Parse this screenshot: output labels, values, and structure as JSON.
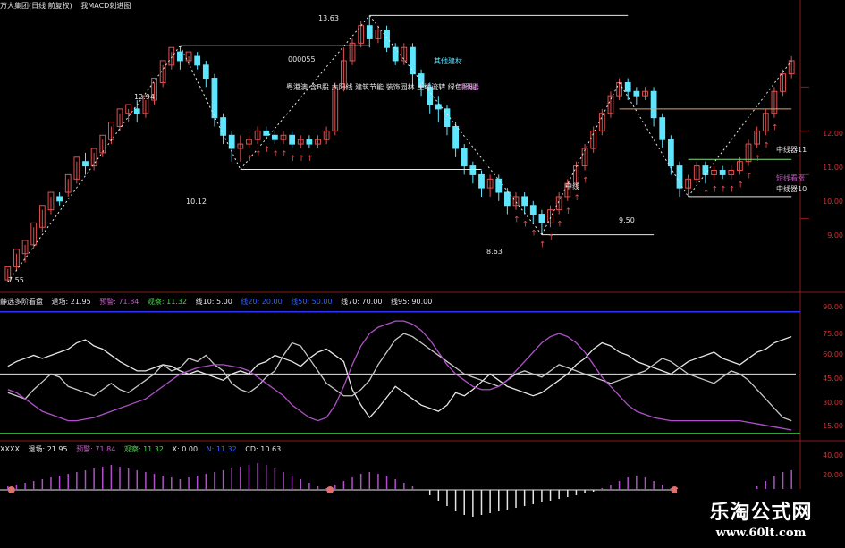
{
  "header": {
    "title": "万大集团(日线 前复权)",
    "indicator": "我MACD刺进图"
  },
  "colors": {
    "up": "#e05050",
    "down": "#5fe6ff",
    "white": "#e6e6e6",
    "magenta": "#b050c8",
    "grid": "#8b1a1a"
  },
  "price_panel": {
    "y_axis": [
      "12.00",
      "11.00",
      "10.00",
      "9.00"
    ],
    "price_labels": [
      "13.63",
      "12.94",
      "10.12",
      "8.63",
      "9.50",
      "7.55"
    ],
    "code_label": "000055",
    "tags": [
      "其他建材",
      "粤港澳 含B股 大阳线 建筑节能 装饰园林 土地流转 绿色照明",
      "中线器"
    ],
    "right_labels": [
      "中线器11",
      "中线器10",
      "短线看涨"
    ],
    "mid_labels": [
      "中线"
    ]
  },
  "osc_panel": {
    "header": [
      {
        "text": "静选多阶看盘",
        "color": "#e6e6e6"
      },
      {
        "text": "退场: 21.95",
        "color": "#e6e6e6"
      },
      {
        "text": "预警: 71.84",
        "color": "#c060c0"
      },
      {
        "text": "观察: 11.32",
        "color": "#50d050"
      },
      {
        "text": "线10: 5.00",
        "color": "#e6e6e6"
      },
      {
        "text": "线20: 20.00",
        "color": "#3060ff"
      },
      {
        "text": "线50: 50.00",
        "color": "#3060ff"
      },
      {
        "text": "线70: 70.00",
        "color": "#e6e6e6"
      },
      {
        "text": "线95: 90.00",
        "color": "#e6e6e6"
      }
    ],
    "y_axis": [
      "90.00",
      "75.00",
      "60.00",
      "45.00",
      "30.00",
      "15.00"
    ]
  },
  "macd_panel": {
    "header": [
      {
        "text": "XXXX",
        "color": "#e6e6e6"
      },
      {
        "text": "退场: 21.95",
        "color": "#e6e6e6"
      },
      {
        "text": "预警: 71.84",
        "color": "#c060c0"
      },
      {
        "text": "观察: 11.32",
        "color": "#50d050"
      },
      {
        "text": "X: 0.00",
        "color": "#e6e6e6"
      },
      {
        "text": "N: 11.32",
        "color": "#3060ff"
      },
      {
        "text": "CD: 10.63",
        "color": "#e6e6e6"
      }
    ],
    "y_axis": [
      "40.00",
      "20.00",
      "0.00"
    ]
  },
  "watermark": {
    "line1": "乐淘公式网",
    "line2": "www.60lt.com"
  },
  "chart_data": {
    "type": "candlestick",
    "title": "万大集团(日线 前复权)",
    "ylim": [
      7.5,
      13.7
    ],
    "candles": [
      [
        7.6,
        7.9,
        7.55,
        7.85
      ],
      [
        7.9,
        8.3,
        7.8,
        8.2
      ],
      [
        8.2,
        8.5,
        8.0,
        8.4
      ],
      [
        8.4,
        8.9,
        8.3,
        8.8
      ],
      [
        8.8,
        9.3,
        8.7,
        9.2
      ],
      [
        9.2,
        9.6,
        9.1,
        9.5
      ],
      [
        9.5,
        9.4,
        9.3,
        9.6
      ],
      [
        9.6,
        10.0,
        9.5,
        9.9
      ],
      [
        9.9,
        10.4,
        9.8,
        10.3
      ],
      [
        10.3,
        10.2,
        10.0,
        10.5
      ],
      [
        10.2,
        10.6,
        10.1,
        10.5
      ],
      [
        10.5,
        10.9,
        10.4,
        10.8
      ],
      [
        10.8,
        11.2,
        10.7,
        11.1
      ],
      [
        11.1,
        11.5,
        11.0,
        11.4
      ],
      [
        11.4,
        11.6,
        11.2,
        11.5
      ],
      [
        11.5,
        11.4,
        11.2,
        11.7
      ],
      [
        11.4,
        11.8,
        11.3,
        11.7
      ],
      [
        11.7,
        12.2,
        11.6,
        12.1
      ],
      [
        12.1,
        12.6,
        12.0,
        12.5
      ],
      [
        12.5,
        12.9,
        12.4,
        12.8
      ],
      [
        12.8,
        12.6,
        12.4,
        12.94
      ],
      [
        12.6,
        12.8,
        12.5,
        12.7
      ],
      [
        12.7,
        12.5,
        12.4,
        12.8
      ],
      [
        12.5,
        12.2,
        12.0,
        12.6
      ],
      [
        12.2,
        11.3,
        11.1,
        12.3
      ],
      [
        11.3,
        10.9,
        10.7,
        11.4
      ],
      [
        10.9,
        10.6,
        10.3,
        11.0
      ],
      [
        10.6,
        10.7,
        10.3,
        10.9
      ],
      [
        10.7,
        10.8,
        10.6,
        10.9
      ],
      [
        10.8,
        11.0,
        10.7,
        11.1
      ],
      [
        11.0,
        10.9,
        10.8,
        11.1
      ],
      [
        10.9,
        10.8,
        10.7,
        11.0
      ],
      [
        10.8,
        10.9,
        10.7,
        11.0
      ],
      [
        10.9,
        10.7,
        10.6,
        11.0
      ],
      [
        10.7,
        10.8,
        10.6,
        10.9
      ],
      [
        10.8,
        10.7,
        10.6,
        10.9
      ],
      [
        10.7,
        10.8,
        10.6,
        10.9
      ],
      [
        10.8,
        11.0,
        10.7,
        11.1
      ],
      [
        11.0,
        12.0,
        10.9,
        12.1
      ],
      [
        12.0,
        12.6,
        11.9,
        12.9
      ],
      [
        12.6,
        13.0,
        12.5,
        13.1
      ],
      [
        13.0,
        13.4,
        12.9,
        13.5
      ],
      [
        13.4,
        13.1,
        12.9,
        13.63
      ],
      [
        13.1,
        13.3,
        13.0,
        13.4
      ],
      [
        13.3,
        12.9,
        12.8,
        13.4
      ],
      [
        12.9,
        12.6,
        12.5,
        13.0
      ],
      [
        12.6,
        12.9,
        12.5,
        13.0
      ],
      [
        12.9,
        12.3,
        12.0,
        13.0
      ],
      [
        12.3,
        12.0,
        11.8,
        12.4
      ],
      [
        12.0,
        11.6,
        11.4,
        12.1
      ],
      [
        11.6,
        11.5,
        11.2,
        11.8
      ],
      [
        11.5,
        11.1,
        10.9,
        11.6
      ],
      [
        11.1,
        10.6,
        10.4,
        11.2
      ],
      [
        10.6,
        10.2,
        10.0,
        10.7
      ],
      [
        10.2,
        10.0,
        9.8,
        10.3
      ],
      [
        10.0,
        9.7,
        9.5,
        10.1
      ],
      [
        9.7,
        9.9,
        9.5,
        10.0
      ],
      [
        9.9,
        9.6,
        9.4,
        10.0
      ],
      [
        9.6,
        9.3,
        9.1,
        9.7
      ],
      [
        9.3,
        9.5,
        9.2,
        9.6
      ],
      [
        9.5,
        9.3,
        9.1,
        9.6
      ],
      [
        9.3,
        9.1,
        8.9,
        9.4
      ],
      [
        9.1,
        8.9,
        8.63,
        9.2
      ],
      [
        8.9,
        9.2,
        8.8,
        9.3
      ],
      [
        9.2,
        9.5,
        9.1,
        9.6
      ],
      [
        9.5,
        9.8,
        9.4,
        9.9
      ],
      [
        9.8,
        10.2,
        9.7,
        10.3
      ],
      [
        10.2,
        10.6,
        10.1,
        10.7
      ],
      [
        10.6,
        11.0,
        10.5,
        11.1
      ],
      [
        11.0,
        11.4,
        10.9,
        11.5
      ],
      [
        11.4,
        11.8,
        11.3,
        11.9
      ],
      [
        11.8,
        12.1,
        11.7,
        12.2
      ],
      [
        12.1,
        11.9,
        11.7,
        12.2
      ],
      [
        11.9,
        11.8,
        11.6,
        12.0
      ],
      [
        11.8,
        11.9,
        11.7,
        12.0
      ],
      [
        11.9,
        11.3,
        11.1,
        12.0
      ],
      [
        11.3,
        10.8,
        10.6,
        11.4
      ],
      [
        10.8,
        10.2,
        10.0,
        10.9
      ],
      [
        10.2,
        9.7,
        9.5,
        10.3
      ],
      [
        9.7,
        9.9,
        9.5,
        10.0
      ],
      [
        9.9,
        10.2,
        9.8,
        10.3
      ],
      [
        10.2,
        10.0,
        9.8,
        10.3
      ],
      [
        10.0,
        10.1,
        9.9,
        10.2
      ],
      [
        10.1,
        10.0,
        9.9,
        10.2
      ],
      [
        10.0,
        10.1,
        9.9,
        10.2
      ],
      [
        10.1,
        10.3,
        10.0,
        10.4
      ],
      [
        10.3,
        10.7,
        10.2,
        10.8
      ],
      [
        10.7,
        11.0,
        10.6,
        11.1
      ],
      [
        11.0,
        11.4,
        10.9,
        11.5
      ],
      [
        11.4,
        11.9,
        11.3,
        12.0
      ],
      [
        11.9,
        12.3,
        11.8,
        12.4
      ],
      [
        12.3,
        12.6,
        12.2,
        12.7
      ]
    ],
    "oscillator": {
      "ylim": [
        10,
        95
      ],
      "white": [
        55,
        58,
        60,
        62,
        60,
        62,
        64,
        66,
        70,
        72,
        68,
        66,
        62,
        58,
        55,
        52,
        52,
        54,
        56,
        55,
        52,
        50,
        52,
        50,
        48,
        46,
        50,
        52,
        50,
        56,
        58,
        62,
        60,
        58,
        55,
        60,
        64,
        66,
        62,
        58,
        40,
        30,
        22,
        28,
        35,
        42,
        38,
        34,
        30,
        28,
        26,
        30,
        38,
        36,
        40,
        45,
        50,
        46,
        42,
        40,
        38,
        36,
        38,
        42,
        46,
        50,
        56,
        60,
        66,
        70,
        68,
        64,
        62,
        58,
        56,
        54,
        52,
        50,
        54,
        58,
        60,
        62,
        64,
        60,
        58,
        56,
        60,
        64,
        66,
        70,
        72,
        74
      ],
      "white2": [
        38,
        36,
        34,
        40,
        45,
        50,
        48,
        42,
        40,
        38,
        36,
        40,
        44,
        40,
        38,
        42,
        46,
        50,
        56,
        52,
        54,
        60,
        58,
        62,
        56,
        52,
        44,
        40,
        38,
        42,
        48,
        52,
        62,
        70,
        68,
        60,
        52,
        44,
        40,
        36,
        36,
        40,
        46,
        56,
        64,
        72,
        76,
        74,
        70,
        66,
        62,
        58,
        54,
        50,
        48,
        46,
        44,
        42,
        46,
        50,
        52,
        50,
        48,
        52,
        56,
        54,
        52,
        50,
        48,
        46,
        44,
        46,
        48,
        50,
        52,
        56,
        60,
        58,
        54,
        50,
        48,
        46,
        44,
        48,
        52,
        50,
        46,
        40,
        34,
        28,
        22,
        20
      ],
      "magenta": [
        40,
        38,
        34,
        30,
        26,
        24,
        22,
        20,
        20,
        21,
        22,
        24,
        26,
        28,
        30,
        32,
        34,
        38,
        42,
        46,
        50,
        52,
        54,
        55,
        56,
        56,
        55,
        54,
        52,
        48,
        44,
        40,
        36,
        30,
        26,
        22,
        20,
        22,
        30,
        42,
        56,
        68,
        76,
        80,
        82,
        84,
        84,
        82,
        78,
        72,
        64,
        56,
        50,
        46,
        42,
        40,
        40,
        42,
        46,
        52,
        58,
        64,
        70,
        74,
        76,
        74,
        70,
        64,
        56,
        48,
        42,
        36,
        30,
        26,
        24,
        22,
        21,
        20,
        20,
        20,
        20,
        20,
        20,
        20,
        20,
        20,
        19,
        18,
        17,
        16,
        15,
        14
      ]
    },
    "macd": {
      "ylim": [
        -40,
        40
      ],
      "bars": [
        4,
        6,
        8,
        10,
        12,
        14,
        16,
        18,
        20,
        22,
        24,
        26,
        28,
        26,
        24,
        22,
        20,
        18,
        16,
        14,
        12,
        14,
        16,
        18,
        20,
        22,
        24,
        26,
        28,
        30,
        28,
        24,
        20,
        16,
        12,
        8,
        4,
        2,
        6,
        10,
        14,
        18,
        20,
        18,
        16,
        12,
        8,
        4,
        0,
        -6,
        -12,
        -18,
        -24,
        -28,
        -30,
        -28,
        -26,
        -24,
        -22,
        -20,
        -18,
        -16,
        -14,
        -12,
        -10,
        -8,
        -6,
        -4,
        -2,
        2,
        6,
        10,
        14,
        16,
        14,
        10,
        6,
        2,
        -2,
        -6,
        -10,
        -14,
        -16,
        -14,
        -10,
        -6,
        -2,
        4,
        10,
        16,
        20,
        22
      ]
    }
  }
}
